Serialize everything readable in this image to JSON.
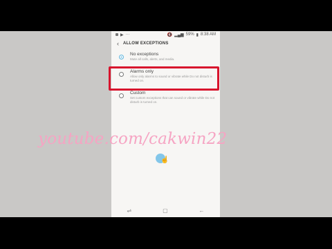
{
  "status_bar": {
    "left_icons": [
      "image-icon",
      "play-icon",
      "more-icon"
    ],
    "battery": "59%",
    "time": "8:38 AM"
  },
  "header": {
    "back_icon": "arrow-left-icon",
    "title": "ALLOW EXCEPTIONS"
  },
  "options": [
    {
      "label": "No exceptions",
      "desc": "Mute all calls, alerts, and media.",
      "checked": true
    },
    {
      "label": "Alarms only",
      "desc": "Allow only alarms to sound or vibrate while Do not disturb is turned on.",
      "checked": false
    },
    {
      "label": "Custom",
      "desc": "Set custom exceptions that can sound or vibrate while Do not disturb is turned on.",
      "checked": false
    }
  ],
  "navbar": {
    "icons": [
      "recent-apps-icon",
      "home-icon",
      "back-icon"
    ]
  },
  "watermark": "youtube.com/cakwin22",
  "colors": {
    "highlight": "#d8142d",
    "radio_checked": "#62b6de",
    "watermark": "#f6a4c3"
  }
}
